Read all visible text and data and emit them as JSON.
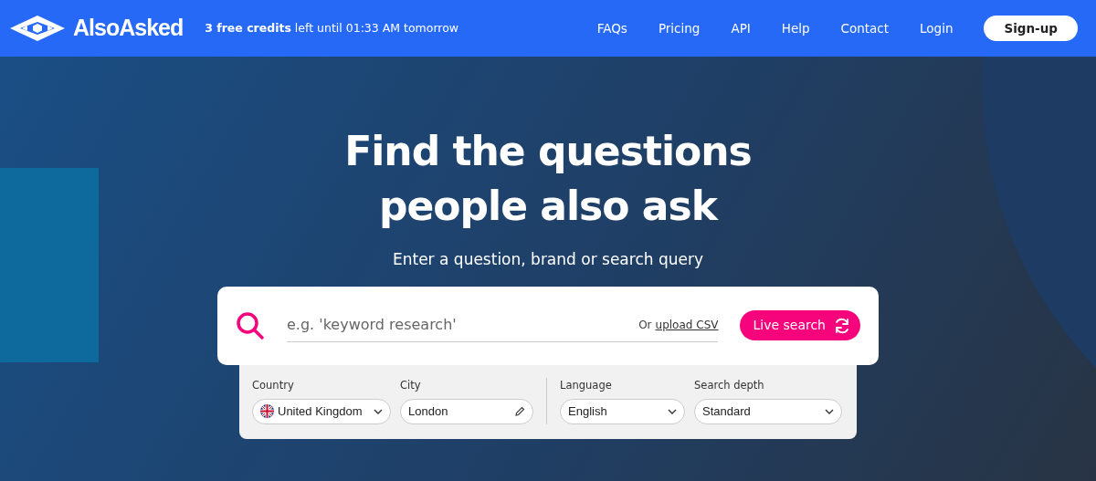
{
  "navbar": {
    "logo": "AlsoAsked",
    "credits": "**3 free credits** left until 01:33 AM tomorrow",
    "links": [
      "FAQs",
      "Pricing",
      "API",
      "Help",
      "Contact",
      "Login"
    ],
    "signup": "Sign-up"
  },
  "hero": {
    "title": "Find the questions people also ask",
    "subtitle": "Enter a question, brand or search query"
  },
  "search": {
    "placeholder": "e.g. 'keyword research'",
    "upload_prefix": "Or",
    "upload_link": "upload CSV",
    "button": "Live search"
  },
  "filters": [
    {
      "kind": "select",
      "label": "Country",
      "value": "United Kingdom",
      "flag": true
    },
    {
      "kind": "text",
      "label": "City",
      "value": "London"
    },
    {
      "kind": "select",
      "label": "Language",
      "value": "English"
    },
    {
      "kind": "select",
      "label": "Search depth",
      "value": "Standard"
    }
  ]
}
